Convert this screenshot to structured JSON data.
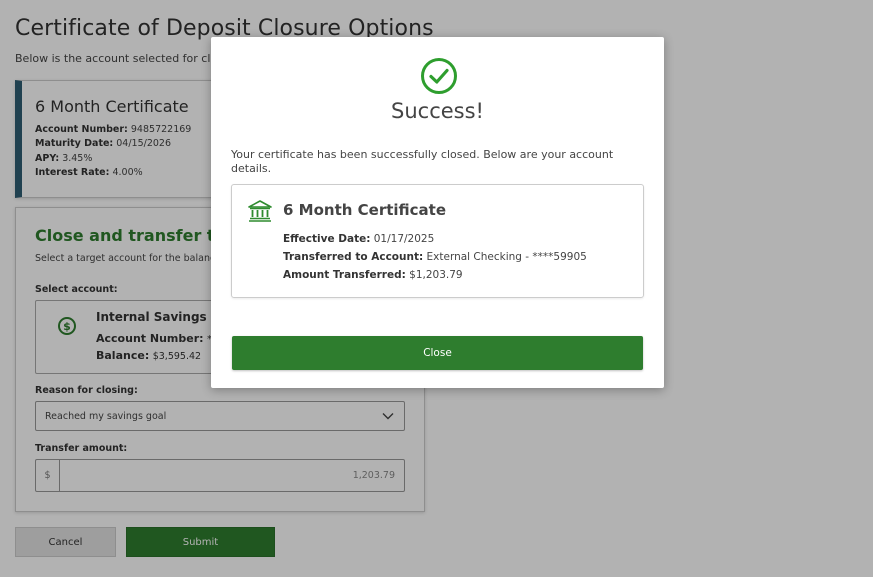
{
  "page": {
    "title": "Certificate of Deposit Closure Options",
    "subtitle": "Below is the account selected for closu"
  },
  "certificate": {
    "name": "6 Month Certificate",
    "account_number_label": "Account Number:",
    "account_number": "9485722169",
    "maturity_date_label": "Maturity Date:",
    "maturity_date": "04/15/2026",
    "apy_label": "APY:",
    "apy": "3.45%",
    "interest_rate_label": "Interest Rate:",
    "interest_rate": "4.00%"
  },
  "close_panel": {
    "heading": "Close and transfer to a",
    "description": "Select a target account for the balance",
    "select_account_label": "Select account:",
    "account": {
      "name": "Internal Savings",
      "account_number_label": "Account Number:",
      "account_number": "***",
      "balance_label": "Balance:",
      "balance": "$3,595.42"
    },
    "reason_label": "Reason for closing:",
    "reason_selected": "Reached my savings goal",
    "transfer_amount_label": "Transfer amount:",
    "currency_prefix": "$",
    "transfer_amount": "1,203.79"
  },
  "actions": {
    "cancel_label": "Cancel",
    "submit_label": "Submit"
  },
  "modal": {
    "title": "Success!",
    "message": "Your certificate has been successfully closed. Below are your account details.",
    "details": {
      "title": "6 Month Certificate",
      "effective_date_label": "Effective Date:",
      "effective_date": "01/17/2025",
      "transferred_to_label": "Transferred to Account:",
      "transferred_to": "External Checking - ****59905",
      "amount_label": "Amount Transferred:",
      "amount": "$1,203.79"
    },
    "close_label": "Close"
  },
  "colors": {
    "primary_green": "#2e7d2e",
    "card_accent": "#2f5e73",
    "overlay": "rgba(0,0,0,0.3)"
  },
  "icons": {
    "success": "check-circle-icon",
    "bank": "bank-icon",
    "dollar": "dollar-circle-icon",
    "chevron": "chevron-down-icon"
  }
}
